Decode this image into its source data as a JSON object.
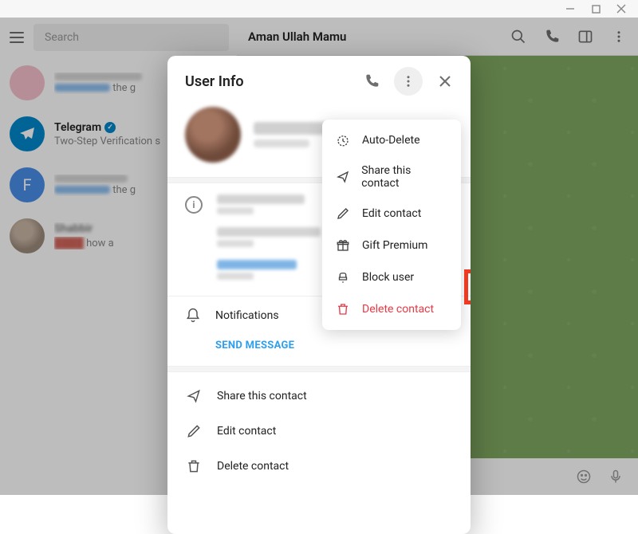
{
  "window": {
    "minimize": "–",
    "maximize": "□",
    "close": "×"
  },
  "sidebar": {
    "search_placeholder": "Search",
    "items": [
      {
        "title": "",
        "sub_prefix": "",
        "sub_tail": " the g"
      },
      {
        "title": "Telegram",
        "sub": "Two-Step Verification s"
      },
      {
        "title": "",
        "sub_prefix": "",
        "sub_tail": " the g"
      },
      {
        "title": "Shabbir",
        "sub_prefix": "",
        "sub_tail": " how a"
      }
    ]
  },
  "header": {
    "title": "Aman Ullah Mamu"
  },
  "modal": {
    "title": "User Info",
    "notifications_label": "Notifications",
    "send_message": "SEND MESSAGE",
    "actions": [
      {
        "icon": "share",
        "label": "Share this contact"
      },
      {
        "icon": "edit",
        "label": "Edit contact"
      },
      {
        "icon": "trash",
        "label": "Delete contact"
      }
    ]
  },
  "dropdown": [
    {
      "icon": "timer",
      "label": "Auto-Delete"
    },
    {
      "icon": "share",
      "label": "Share this contact"
    },
    {
      "icon": "edit",
      "label": "Edit contact"
    },
    {
      "icon": "gift",
      "label": "Gift Premium"
    },
    {
      "icon": "block",
      "label": "Block user"
    },
    {
      "icon": "trash",
      "label": "Delete contact",
      "danger": true
    }
  ]
}
